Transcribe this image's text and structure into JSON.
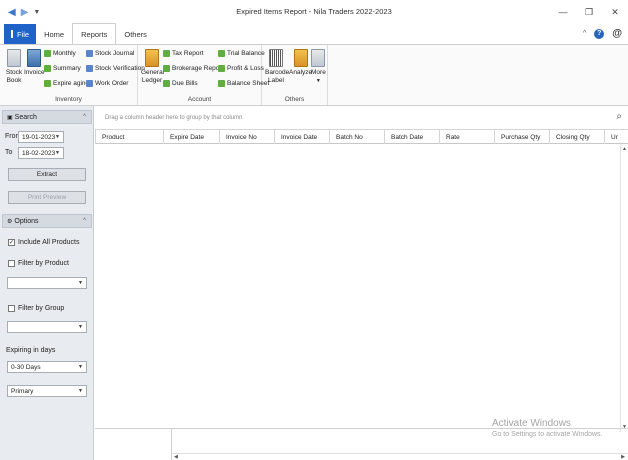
{
  "window": {
    "title": "Expired Items Report - Nila Traders 2022-2023",
    "back": "◀",
    "forward": "▶",
    "quick_access": "▼",
    "minimize": "—",
    "restore": "❐",
    "close": "✕"
  },
  "ribbon_tabs": [
    {
      "label": "File"
    },
    {
      "label": "Home"
    },
    {
      "label": "Reports"
    },
    {
      "label": "Others"
    }
  ],
  "ribbon_right": {
    "collapse": "^",
    "help": "?",
    "at": "@"
  },
  "groups": {
    "inventory": {
      "label": "Inventory",
      "stock_book": "Stock Book",
      "invoice": "Invoice",
      "monthly": "Monthly",
      "summary": "Summary",
      "expire_aging": "Expire aging",
      "stock_journal": "Stock Journal",
      "stock_verification": "Stock Verification",
      "work_order": "Work Order"
    },
    "account": {
      "label": "Account",
      "general_ledger": "General Ledger",
      "tax_report": "Tax Report",
      "brokerage_report": "Brokerage Report",
      "due_bills": "Due Bills",
      "trial_balance": "Trial Balance",
      "profit_loss": "Profit & Loss",
      "balance_sheet": "Balance Sheet"
    },
    "others": {
      "label": "Others",
      "barcode_label": "Barcode Label",
      "analyze": "Analyze",
      "more": "More"
    }
  },
  "search_panel": {
    "header": "Search",
    "from_label": "From",
    "from_value": "19-01-2023",
    "to_label": "To",
    "to_value": "18-02-2023",
    "extract": "Extract",
    "print_preview": "Print Preview"
  },
  "options_panel": {
    "header": "Options",
    "include_all": "Include All Products",
    "include_all_checked": "✓",
    "filter_product": "Filter by Product",
    "filter_product_value": "",
    "filter_group": "Filter by Group",
    "filter_group_value": "",
    "expiring_label": "Expiring in days",
    "expiring_value": "0-30 Days",
    "unit_value": "Primary"
  },
  "grid": {
    "group_hint": "Drag a column header here to group by that column",
    "columns": [
      "Product",
      "Expire Date",
      "Invoice No",
      "Invoice Date",
      "Batch No",
      "Batch Date",
      "Rate",
      "Purchase Qty",
      "Closing Qty",
      "Ur"
    ]
  },
  "watermark": {
    "line1": "Activate Windows",
    "line2": "Go to Settings to activate Windows."
  },
  "colors": {
    "file_tab": "#1f63c9",
    "panel_bg": "#e8ebef"
  }
}
